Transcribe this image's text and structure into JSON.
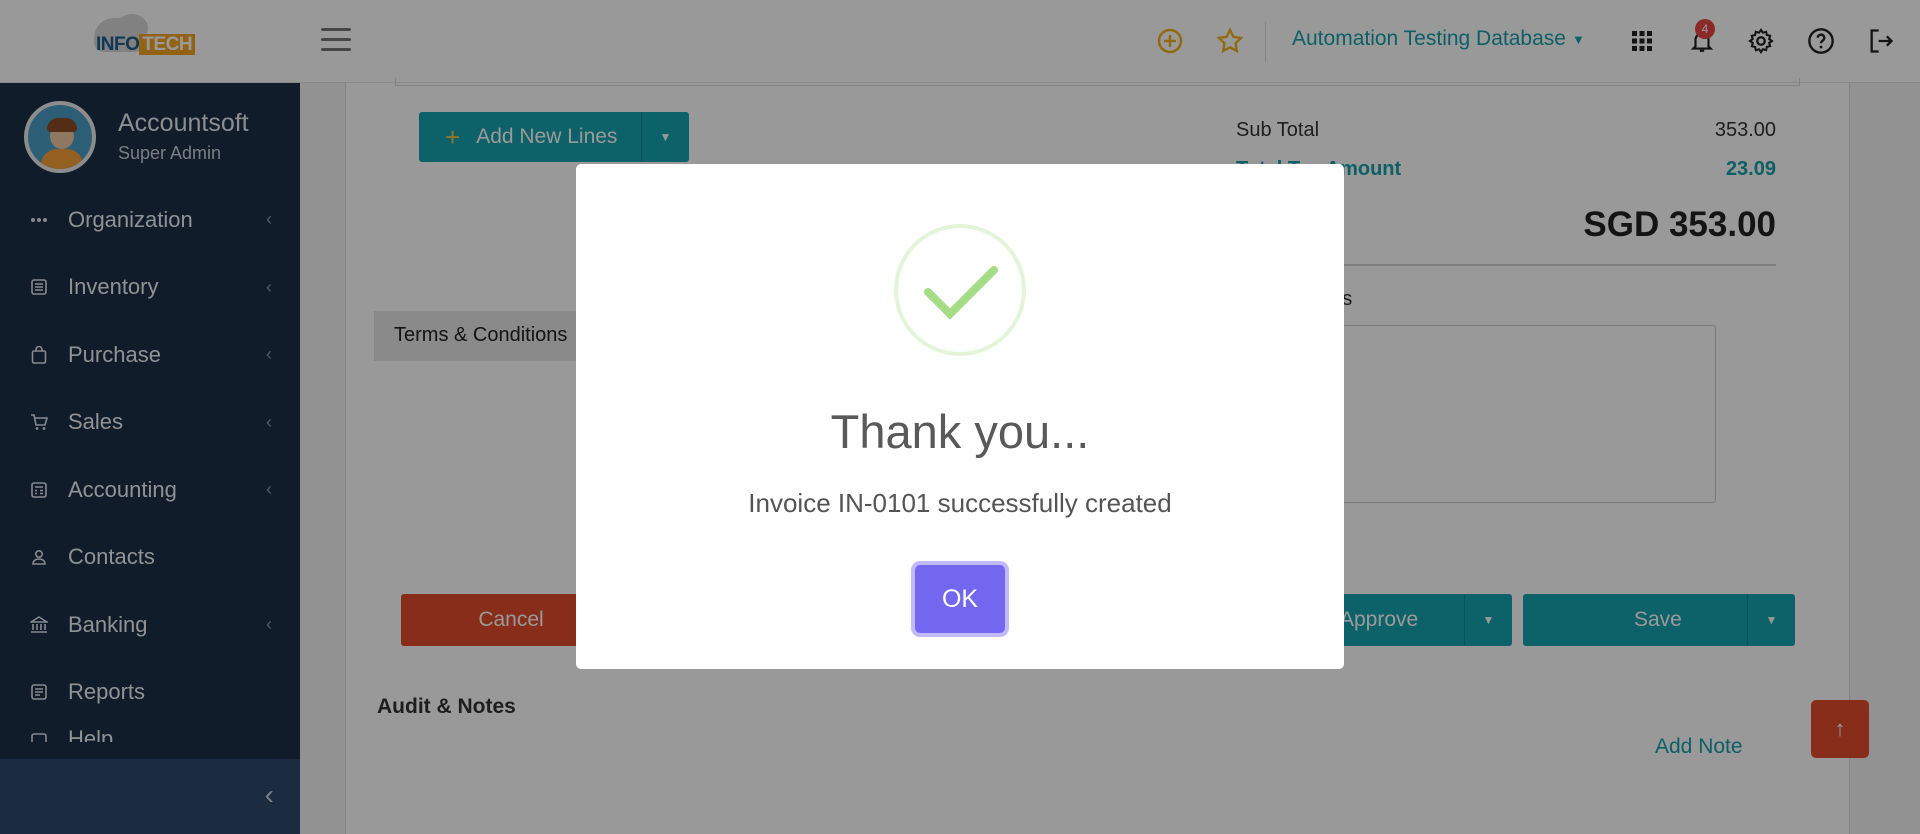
{
  "header": {
    "logo_text_a": "INFO",
    "logo_text_b": "TECH",
    "database": "Automation Testing Database",
    "notification_count": "4",
    "icons": [
      "hamburger-icon",
      "plus-circle-icon",
      "star-icon",
      "apps-grid-icon",
      "bell-icon",
      "gear-icon",
      "help-icon",
      "logout-icon"
    ],
    "accent_color": "#17a0a8",
    "highlight_color": "#f5a623"
  },
  "sidebar": {
    "user_name": "Accountsoft",
    "user_role": "Super Admin",
    "items": [
      {
        "label": "Organization",
        "icon": "dots-icon",
        "has_submenu": true
      },
      {
        "label": "Inventory",
        "icon": "inventory-icon",
        "has_submenu": true
      },
      {
        "label": "Purchase",
        "icon": "shopping-bag-icon",
        "has_submenu": true
      },
      {
        "label": "Sales",
        "icon": "cart-icon",
        "has_submenu": true
      },
      {
        "label": "Accounting",
        "icon": "calculator-icon",
        "has_submenu": true
      },
      {
        "label": "Contacts",
        "icon": "person-icon",
        "has_submenu": false
      },
      {
        "label": "Banking",
        "icon": "bank-icon",
        "has_submenu": true
      },
      {
        "label": "Reports",
        "icon": "report-icon",
        "has_submenu": false
      },
      {
        "label": "Help",
        "icon": "help-doc-icon",
        "has_submenu": true
      }
    ],
    "bg_color": "#1c2f45"
  },
  "invoice": {
    "add_lines_label": "Add New Lines",
    "sub_total_label": "Sub Total",
    "sub_total_value": "353.00",
    "tax_label": "Total Tax Amount",
    "tax_value": "23.09",
    "grand_total": "SGD 353.00",
    "terms_tab": "Terms & Conditions",
    "notes_label": "Notes",
    "cancel_label": "Cancel",
    "approve_label": "Approve",
    "save_label": "Save",
    "audit_label": "Audit & Notes",
    "add_note_label": "Add Note"
  },
  "modal": {
    "title": "Thank you...",
    "message": "Invoice IN-0101 successfully created",
    "ok_label": "OK",
    "ok_color": "#7367f0",
    "icon": "check-success-icon"
  }
}
